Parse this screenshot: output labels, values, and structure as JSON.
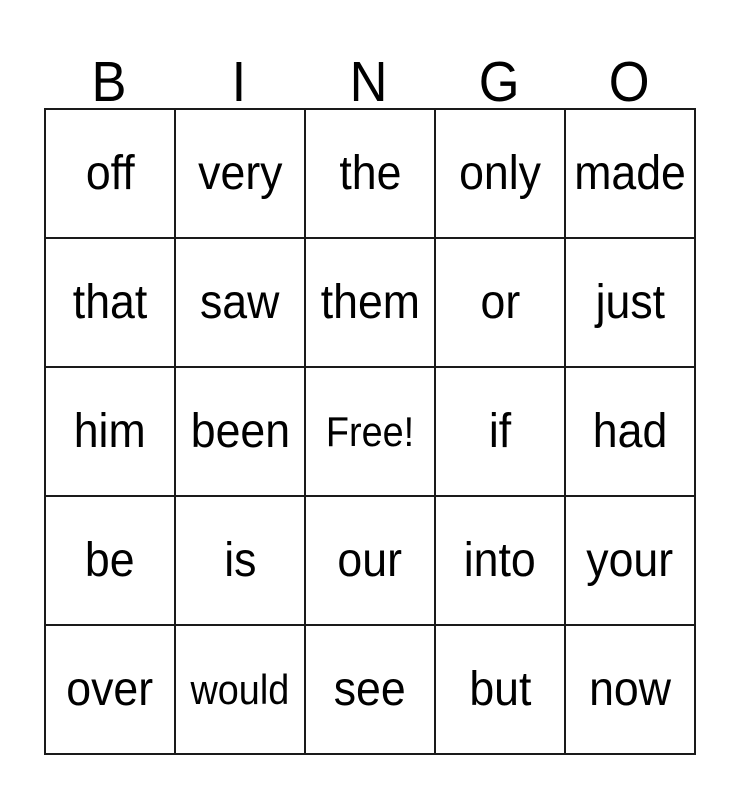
{
  "card": {
    "title": "BINGO",
    "free_space_label": "Free!",
    "header": {
      "letters": [
        "B",
        "I",
        "N",
        "G",
        "O"
      ]
    },
    "grid": {
      "columns": 5,
      "rows": 5,
      "cells": [
        [
          "off",
          "very",
          "the",
          "only",
          "made"
        ],
        [
          "that",
          "saw",
          "them",
          "or",
          "just"
        ],
        [
          "him",
          "been",
          "Free!",
          "if",
          "had"
        ],
        [
          "be",
          "is",
          "our",
          "into",
          "your"
        ],
        [
          "over",
          "would",
          "see",
          "but",
          "now"
        ]
      ]
    },
    "colors": {
      "background": "#ffffff",
      "border": "#1a1a1a",
      "text": "#000000"
    }
  }
}
